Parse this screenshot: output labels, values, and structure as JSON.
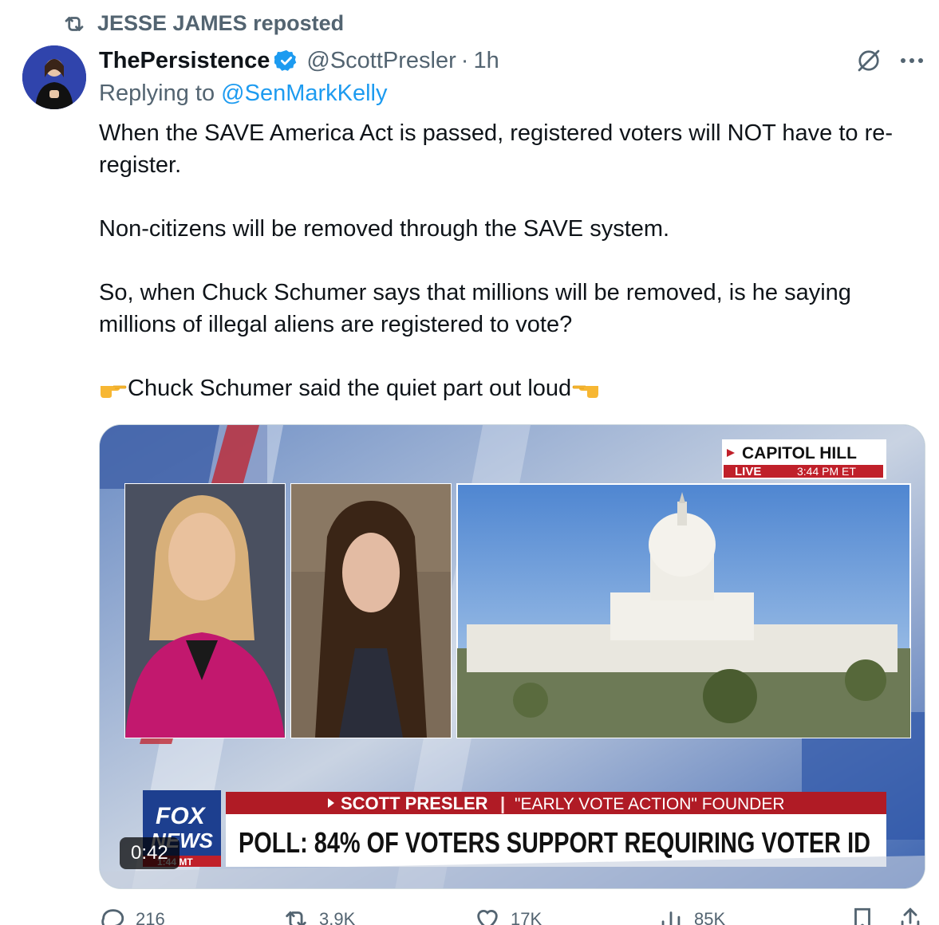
{
  "repost": {
    "label": "JESSE JAMES reposted",
    "icon": "repost-icon"
  },
  "author": {
    "display_name": "ThePersistence",
    "handle": "@ScottPresler",
    "separator": "·",
    "time": "1h",
    "verified_color": "#1d9bf0"
  },
  "reply": {
    "prefix": "Replying to",
    "mention": "@SenMarkKelly"
  },
  "body": {
    "line1": "When the SAVE America Act is passed, registered voters will NOT have to re-register.",
    "line2": "Non-citizens will be removed through the SAVE system.",
    "line3": "So, when Chuck Schumer says that millions will be removed, is he saying millions of illegal aliens are registered to vote?",
    "line4": "Chuck Schumer said the quiet part out loud"
  },
  "media": {
    "duration": "0:42",
    "location_label": "CAPITOL HILL",
    "live_label": "LIVE",
    "live_time": "3:44 PM ET",
    "network_top": "FOX",
    "network_bottom": "NEWS",
    "network_time": "1:44 MT",
    "lower_third_name": "SCOTT PRESLER",
    "lower_third_title": "\"EARLY VOTE ACTION\" FOUNDER",
    "headline": "POLL: 84% OF VOTERS SUPPORT REQUIRING VOTER ID"
  },
  "actions": {
    "replies": "216",
    "reposts": "3.9K",
    "likes": "17K",
    "views": "85K"
  },
  "colors": {
    "accent": "#1d9bf0",
    "muted": "#536471",
    "fox_red": "#c0202a"
  }
}
